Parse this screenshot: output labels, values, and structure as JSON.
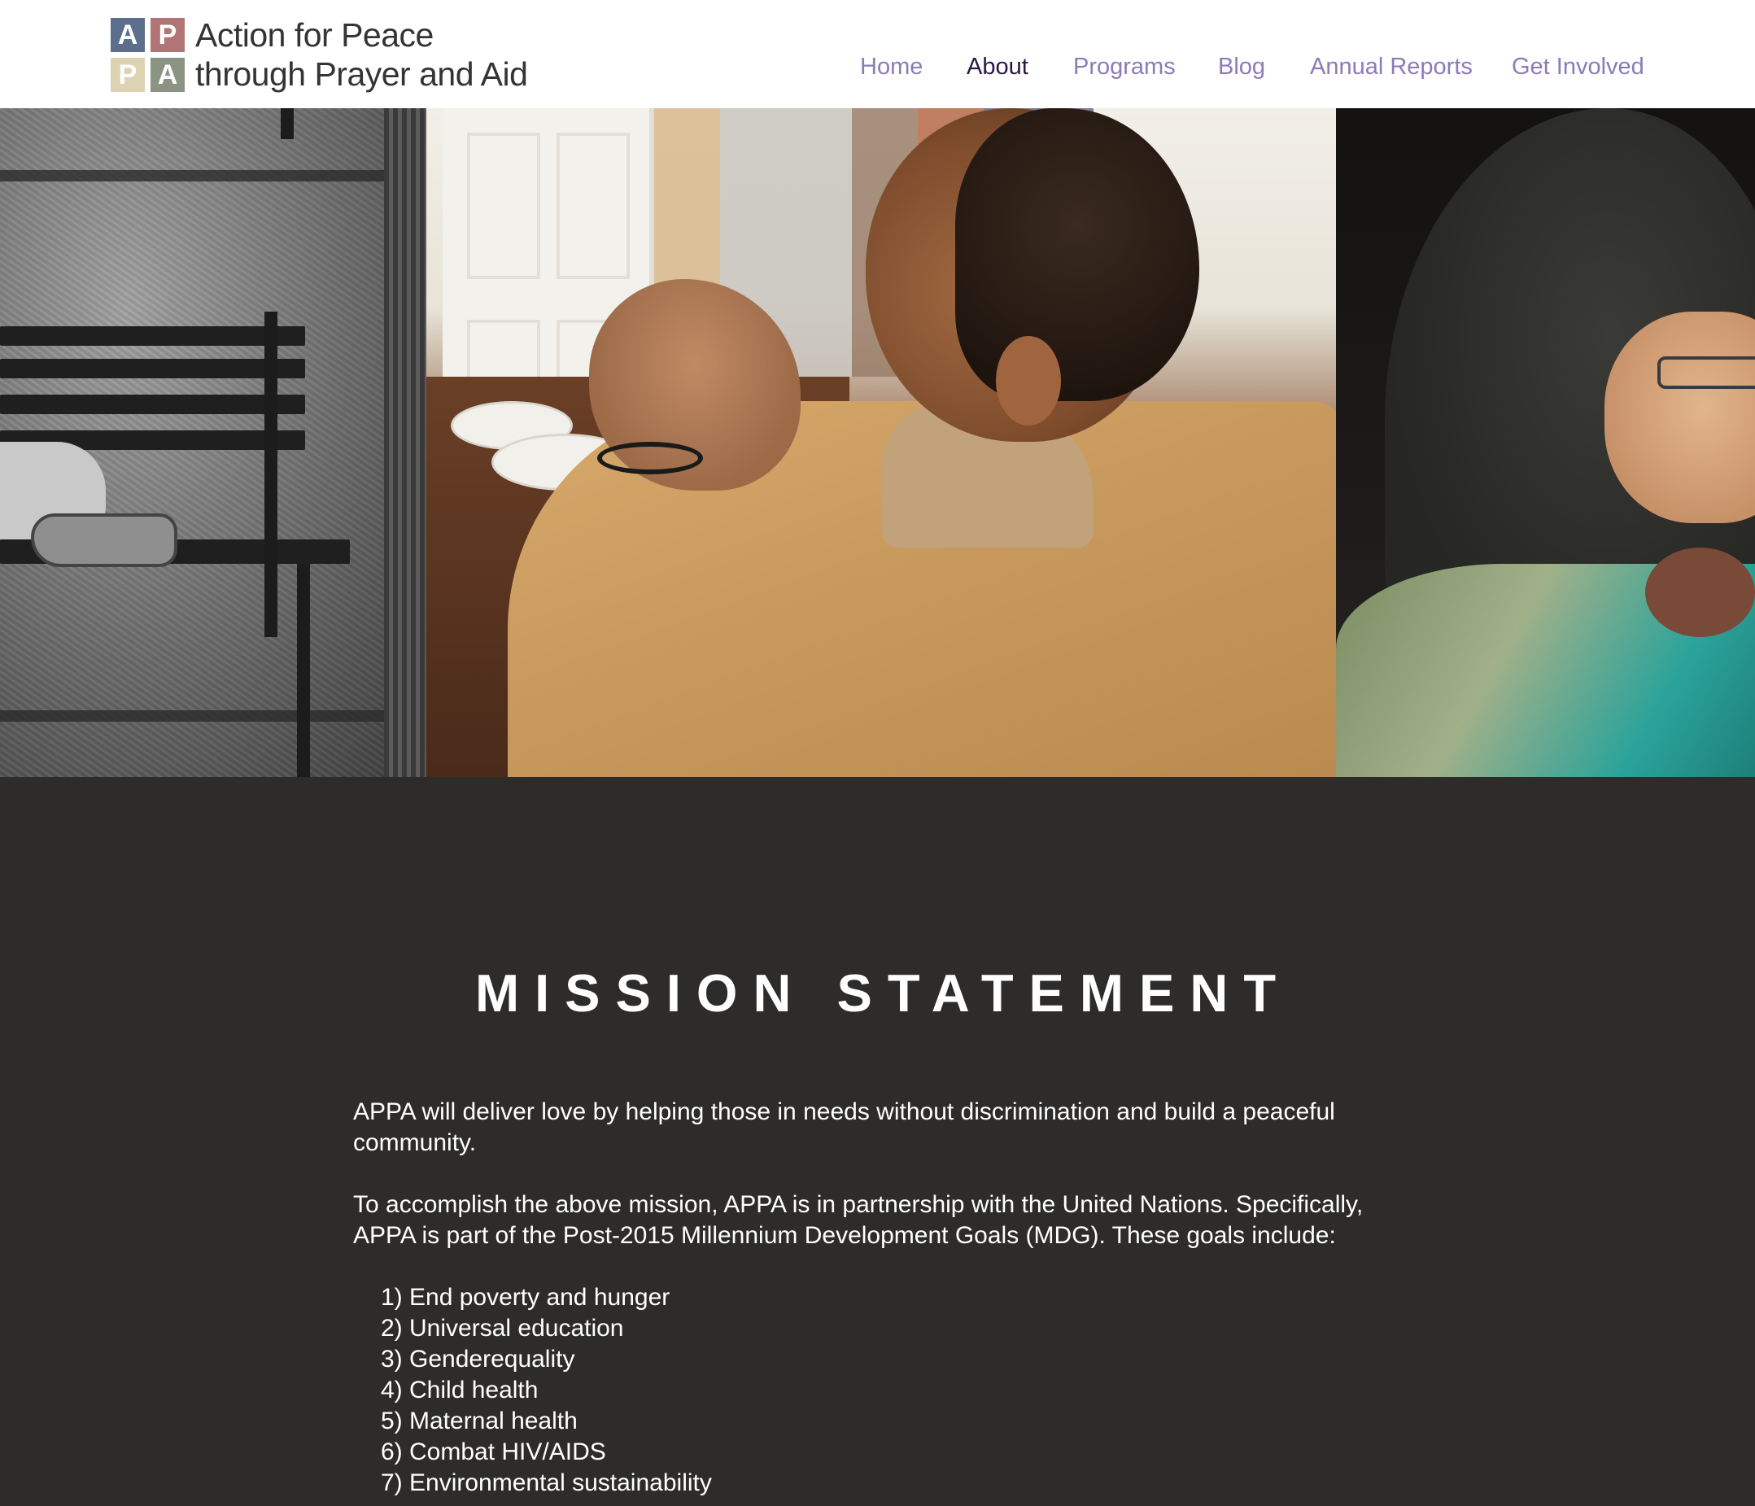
{
  "logo": {
    "tiles": [
      "A",
      "P",
      "P",
      "A"
    ],
    "line1": "Action for Peace",
    "line2": "through Prayer and Aid",
    "tile_colors": [
      "#5b6f8c",
      "#b27575",
      "#ddd3b2",
      "#8b9482"
    ]
  },
  "nav": {
    "items": [
      {
        "label": "Home"
      },
      {
        "label": "About"
      },
      {
        "label": "Programs"
      },
      {
        "label": "Blog"
      },
      {
        "label": "Annual Reports"
      },
      {
        "label": "Get Involved"
      }
    ],
    "active": "About",
    "link_color": "#8c7bb8",
    "active_color": "#2b1745"
  },
  "mission": {
    "title": "MISSION STATEMENT",
    "paragraph1": "APPA will deliver love by helping those in needs without discrimination and build a peaceful community.",
    "paragraph2": "To accomplish the above mission, APPA is in partnership with the United Nations. Specifically, APPA is part of the Post-2015 Millennium Development Goals (MDG). These goals include:",
    "goals": [
      "1) End poverty and hunger",
      "2) Universal education",
      "3) Genderequality",
      "4) Child health",
      "5) Maternal health",
      "6) Combat HIV/AIDS",
      "7) Environmental sustainability"
    ],
    "background_color": "#2d2c2b"
  }
}
